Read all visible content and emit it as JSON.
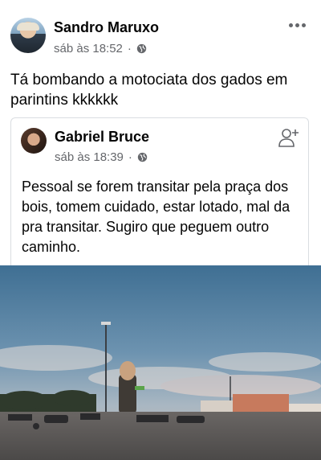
{
  "post": {
    "author": "Sandro Maruxo",
    "timestamp": "sáb às 18:52",
    "privacy_icon": "globe-icon",
    "more_icon": "more-options-icon",
    "text": "Tá bombando a motociata dos gados em parintins kkkkkk"
  },
  "shared_post": {
    "author": "Gabriel Bruce",
    "timestamp": "sáb às 18:39",
    "privacy_icon": "globe-icon",
    "action_icon": "add-friend-icon",
    "text": "Pessoal se forem transitar pela praça dos bois, tomem cuidado, estar lotado, mal da pra transitar.  Sugiro que peguem outro caminho."
  },
  "colors": {
    "text": "#050505",
    "secondary": "#65676b",
    "border": "#dadde1"
  }
}
